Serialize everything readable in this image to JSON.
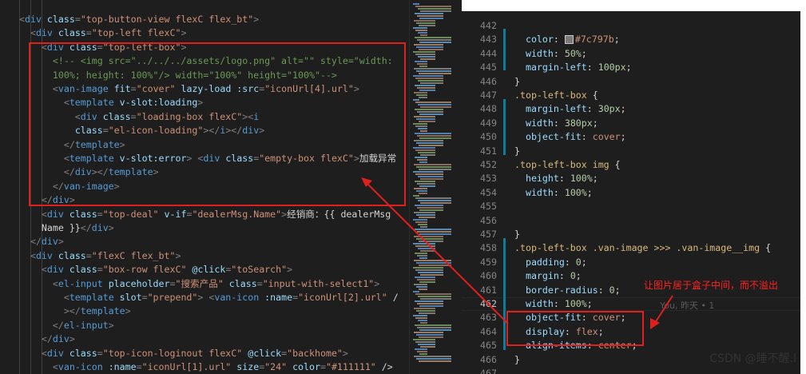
{
  "left_lines": [
    [
      [
        "t-punc",
        "<"
      ],
      [
        "t-tag",
        "div"
      ],
      [
        "t-text",
        " "
      ],
      [
        "t-attr",
        "class"
      ],
      [
        "t-punc",
        "="
      ],
      [
        "t-str",
        "\"top-button-view flexC flex_bt\""
      ],
      [
        "t-punc",
        ">"
      ]
    ],
    [
      [
        "t-punc",
        "  <"
      ],
      [
        "t-tag",
        "div"
      ],
      [
        "t-text",
        " "
      ],
      [
        "t-attr",
        "class"
      ],
      [
        "t-punc",
        "="
      ],
      [
        "t-str",
        "\"top-left flexC\""
      ],
      [
        "t-punc",
        ">"
      ]
    ],
    [
      [
        "t-punc",
        "    <"
      ],
      [
        "t-tag",
        "div"
      ],
      [
        "t-text",
        " "
      ],
      [
        "t-attr",
        "class"
      ],
      [
        "t-punc",
        "="
      ],
      [
        "t-str",
        "\"top-left-box\""
      ],
      [
        "t-punc",
        ">"
      ]
    ],
    [
      [
        "t-comm",
        "      <!-- <img src=\"../../../assets/logo.png\" alt=\"\" style=\"width:"
      ]
    ],
    [
      [
        "t-comm",
        "      100%; height: 100%\"/> width=\"100%\" height=\"100%\"-->"
      ]
    ],
    [
      [
        "t-punc",
        "      <"
      ],
      [
        "t-tag",
        "van-image"
      ],
      [
        "t-text",
        " "
      ],
      [
        "t-attr",
        "fit"
      ],
      [
        "t-punc",
        "="
      ],
      [
        "t-str",
        "\"cover\""
      ],
      [
        "t-text",
        " "
      ],
      [
        "t-attr",
        "lazy-load"
      ],
      [
        "t-text",
        " "
      ],
      [
        "t-attr",
        ":src"
      ],
      [
        "t-punc",
        "="
      ],
      [
        "t-str",
        "\"iconUrl[4].url\""
      ],
      [
        "t-punc",
        ">"
      ]
    ],
    [
      [
        "t-punc",
        "        <"
      ],
      [
        "t-tag",
        "template"
      ],
      [
        "t-text",
        " "
      ],
      [
        "t-attr",
        "v-slot:loading"
      ],
      [
        "t-punc",
        ">"
      ]
    ],
    [
      [
        "t-punc",
        "          <"
      ],
      [
        "t-tag",
        "div"
      ],
      [
        "t-text",
        " "
      ],
      [
        "t-attr",
        "class"
      ],
      [
        "t-punc",
        "="
      ],
      [
        "t-str",
        "\"loading-box flexC\""
      ],
      [
        "t-punc",
        "><"
      ],
      [
        "t-tag",
        "i"
      ]
    ],
    [
      [
        "t-text",
        "          "
      ],
      [
        "t-attr",
        "class"
      ],
      [
        "t-punc",
        "="
      ],
      [
        "t-str",
        "\"el-icon-loading\""
      ],
      [
        "t-punc",
        "></"
      ],
      [
        "t-tag",
        "i"
      ],
      [
        "t-punc",
        "></"
      ],
      [
        "t-tag",
        "div"
      ],
      [
        "t-punc",
        ">"
      ]
    ],
    [
      [
        "t-punc",
        "        </"
      ],
      [
        "t-tag",
        "template"
      ],
      [
        "t-punc",
        ">"
      ]
    ],
    [
      [
        "t-punc",
        "        <"
      ],
      [
        "t-tag",
        "template"
      ],
      [
        "t-text",
        " "
      ],
      [
        "t-attr",
        "v-slot:error"
      ],
      [
        "t-punc",
        "> <"
      ],
      [
        "t-tag",
        "div"
      ],
      [
        "t-text",
        " "
      ],
      [
        "t-attr",
        "class"
      ],
      [
        "t-punc",
        "="
      ],
      [
        "t-str",
        "\"empty-box flexC\""
      ],
      [
        "t-punc",
        ">"
      ],
      [
        "t-cn",
        "加载异常"
      ]
    ],
    [
      [
        "t-punc",
        "        </"
      ],
      [
        "t-tag",
        "div"
      ],
      [
        "t-punc",
        "></"
      ],
      [
        "t-tag",
        "template"
      ],
      [
        "t-punc",
        ">"
      ]
    ],
    [
      [
        "t-punc",
        "      </"
      ],
      [
        "t-tag",
        "van-image"
      ],
      [
        "t-punc",
        ">"
      ]
    ],
    [
      [
        "t-punc",
        "    </"
      ],
      [
        "t-tag",
        "div"
      ],
      [
        "t-punc",
        ">"
      ]
    ],
    [
      [
        "t-punc",
        "    <"
      ],
      [
        "t-tag",
        "div"
      ],
      [
        "t-text",
        " "
      ],
      [
        "t-attr",
        "class"
      ],
      [
        "t-punc",
        "="
      ],
      [
        "t-str",
        "\"top-deal\""
      ],
      [
        "t-text",
        " "
      ],
      [
        "t-attr",
        "v-if"
      ],
      [
        "t-punc",
        "="
      ],
      [
        "t-str",
        "\"dealerMsg.Name\""
      ],
      [
        "t-punc",
        ">"
      ],
      [
        "t-cn",
        "经销商："
      ],
      [
        "t-text",
        "{{ dealerMsg"
      ]
    ],
    [
      [
        "t-text",
        "    Name }}"
      ],
      [
        "t-punc",
        "</"
      ],
      [
        "t-tag",
        "div"
      ],
      [
        "t-punc",
        ">"
      ]
    ],
    [
      [
        "t-punc",
        "  </"
      ],
      [
        "t-tag",
        "div"
      ],
      [
        "t-punc",
        ">"
      ]
    ],
    [
      [
        "t-punc",
        "  <"
      ],
      [
        "t-tag",
        "div"
      ],
      [
        "t-text",
        " "
      ],
      [
        "t-attr",
        "class"
      ],
      [
        "t-punc",
        "="
      ],
      [
        "t-str",
        "\"flexC flex_bt\""
      ],
      [
        "t-punc",
        ">"
      ]
    ],
    [
      [
        "t-punc",
        "    <"
      ],
      [
        "t-tag",
        "div"
      ],
      [
        "t-text",
        " "
      ],
      [
        "t-attr",
        "class"
      ],
      [
        "t-punc",
        "="
      ],
      [
        "t-str",
        "\"box-row flexC\""
      ],
      [
        "t-text",
        " "
      ],
      [
        "t-attr",
        "@click"
      ],
      [
        "t-punc",
        "="
      ],
      [
        "t-str",
        "\"toSearch\""
      ],
      [
        "t-punc",
        ">"
      ]
    ],
    [
      [
        "t-punc",
        "      <"
      ],
      [
        "t-tag",
        "el-input"
      ],
      [
        "t-text",
        " "
      ],
      [
        "t-attr",
        "placeholder"
      ],
      [
        "t-punc",
        "="
      ],
      [
        "t-str",
        "\"搜索产品\""
      ],
      [
        "t-text",
        " "
      ],
      [
        "t-attr",
        "class"
      ],
      [
        "t-punc",
        "="
      ],
      [
        "t-str",
        "\"input-with-select1\""
      ],
      [
        "t-punc",
        ">"
      ]
    ],
    [
      [
        "t-punc",
        "        <"
      ],
      [
        "t-tag",
        "template"
      ],
      [
        "t-text",
        " "
      ],
      [
        "t-attr",
        "slot"
      ],
      [
        "t-punc",
        "="
      ],
      [
        "t-str",
        "\"prepend\""
      ],
      [
        "t-punc",
        "> <"
      ],
      [
        "t-tag",
        "van-icon"
      ],
      [
        "t-text",
        " "
      ],
      [
        "t-attr",
        ":name"
      ],
      [
        "t-punc",
        "="
      ],
      [
        "t-str",
        "\"iconUrl[2].url\""
      ],
      [
        "t-text",
        " /"
      ]
    ],
    [
      [
        "t-punc",
        "        ></"
      ],
      [
        "t-tag",
        "template"
      ],
      [
        "t-punc",
        ">"
      ]
    ],
    [
      [
        "t-punc",
        "      </"
      ],
      [
        "t-tag",
        "el-input"
      ],
      [
        "t-punc",
        ">"
      ]
    ],
    [
      [
        "t-punc",
        "    </"
      ],
      [
        "t-tag",
        "div"
      ],
      [
        "t-punc",
        ">"
      ]
    ],
    [
      [
        "t-punc",
        "    <"
      ],
      [
        "t-tag",
        "div"
      ],
      [
        "t-text",
        " "
      ],
      [
        "t-attr",
        "class"
      ],
      [
        "t-punc",
        "="
      ],
      [
        "t-str",
        "\"top-icon-loginout flexC\""
      ],
      [
        "t-text",
        " "
      ],
      [
        "t-attr",
        "@click"
      ],
      [
        "t-punc",
        "="
      ],
      [
        "t-str",
        "\"backhome\""
      ],
      [
        "t-punc",
        ">"
      ]
    ],
    [
      [
        "t-punc",
        "      <"
      ],
      [
        "t-tag",
        "van-icon"
      ],
      [
        "t-text",
        " "
      ],
      [
        "t-attr",
        ":name"
      ],
      [
        "t-punc",
        "="
      ],
      [
        "t-str",
        "\"iconUrl[1].url\""
      ],
      [
        "t-text",
        " "
      ],
      [
        "t-attr",
        "size"
      ],
      [
        "t-punc",
        "="
      ],
      [
        "t-str",
        "\"24\""
      ],
      [
        "t-text",
        " "
      ],
      [
        "t-attr",
        "color"
      ],
      [
        "t-punc",
        "="
      ],
      [
        "t-str",
        "\"#111111\""
      ],
      [
        "t-text",
        " />"
      ]
    ]
  ],
  "right_lines": [
    {
      "n": "442",
      "tokens": []
    },
    {
      "n": "443",
      "tokens": [
        [
          "t-prop",
          "  color"
        ],
        [
          "t-text",
          ": "
        ],
        [
          "swatch",
          ""
        ],
        [
          "t-val",
          "#7c797b"
        ],
        [
          "t-text",
          ";"
        ]
      ]
    },
    {
      "n": "444",
      "tokens": [
        [
          "t-prop",
          "  width"
        ],
        [
          "t-text",
          ": "
        ],
        [
          "t-num",
          "50%"
        ],
        [
          "t-text",
          ";"
        ]
      ]
    },
    {
      "n": "445",
      "tokens": [
        [
          "t-prop",
          "  margin-left"
        ],
        [
          "t-text",
          ": "
        ],
        [
          "t-num",
          "100px"
        ],
        [
          "t-text",
          ";"
        ]
      ]
    },
    {
      "n": "446",
      "tokens": [
        [
          "t-brace",
          "}"
        ]
      ]
    },
    {
      "n": "447",
      "tokens": [
        [
          "t-sel",
          ".top-left-box"
        ],
        [
          "t-brace",
          " {"
        ]
      ]
    },
    {
      "n": "448",
      "tokens": [
        [
          "t-prop",
          "  margin-left"
        ],
        [
          "t-text",
          ": "
        ],
        [
          "t-num",
          "30px"
        ],
        [
          "t-text",
          ";"
        ]
      ]
    },
    {
      "n": "449",
      "tokens": [
        [
          "t-prop",
          "  width"
        ],
        [
          "t-text",
          ": "
        ],
        [
          "t-num",
          "380px"
        ],
        [
          "t-text",
          ";"
        ]
      ]
    },
    {
      "n": "450",
      "tokens": [
        [
          "t-prop",
          "  object-fit"
        ],
        [
          "t-text",
          ": "
        ],
        [
          "t-val",
          "cover"
        ],
        [
          "t-text",
          ";"
        ]
      ]
    },
    {
      "n": "451",
      "tokens": [
        [
          "t-brace",
          "}"
        ]
      ]
    },
    {
      "n": "452",
      "tokens": [
        [
          "t-sel",
          ".top-left-box img"
        ],
        [
          "t-brace",
          " {"
        ]
      ]
    },
    {
      "n": "453",
      "tokens": [
        [
          "t-prop",
          "  height"
        ],
        [
          "t-text",
          ": "
        ],
        [
          "t-num",
          "100%"
        ],
        [
          "t-text",
          ";"
        ]
      ]
    },
    {
      "n": "454",
      "tokens": [
        [
          "t-prop",
          "  width"
        ],
        [
          "t-text",
          ": "
        ],
        [
          "t-num",
          "100%"
        ],
        [
          "t-text",
          ";"
        ]
      ]
    },
    {
      "n": "455",
      "tokens": []
    },
    {
      "n": "456",
      "tokens": []
    },
    {
      "n": "457",
      "tokens": [
        [
          "t-brace",
          "}"
        ]
      ]
    },
    {
      "n": "458",
      "tokens": [
        [
          "t-sel",
          ".top-left-box .van-image >>> .van-image__img"
        ],
        [
          "t-brace",
          " {"
        ]
      ]
    },
    {
      "n": "459",
      "tokens": [
        [
          "t-prop",
          "  padding"
        ],
        [
          "t-text",
          ": "
        ],
        [
          "t-num",
          "0"
        ],
        [
          "t-text",
          ";"
        ]
      ]
    },
    {
      "n": "460",
      "tokens": [
        [
          "t-prop",
          "  margin"
        ],
        [
          "t-text",
          ": "
        ],
        [
          "t-num",
          "0"
        ],
        [
          "t-text",
          ";"
        ]
      ]
    },
    {
      "n": "461",
      "tokens": [
        [
          "t-prop",
          "  border-radius"
        ],
        [
          "t-text",
          ": "
        ],
        [
          "t-num",
          "0"
        ],
        [
          "t-text",
          ";"
        ]
      ]
    },
    {
      "n": "462",
      "tokens": [
        [
          "t-prop",
          "  width"
        ],
        [
          "t-text",
          ": "
        ],
        [
          "t-num",
          "100%"
        ],
        [
          "t-text",
          ";"
        ]
      ]
    },
    {
      "n": "463",
      "tokens": [
        [
          "t-prop",
          "  object-fit"
        ],
        [
          "t-text",
          ": "
        ],
        [
          "t-val",
          "cover"
        ],
        [
          "t-text",
          ";"
        ]
      ]
    },
    {
      "n": "464",
      "tokens": [
        [
          "t-prop",
          "  display"
        ],
        [
          "t-text",
          ": "
        ],
        [
          "t-val",
          "flex"
        ],
        [
          "t-text",
          ";"
        ]
      ]
    },
    {
      "n": "465",
      "tokens": [
        [
          "t-prop",
          "  align-items"
        ],
        [
          "t-text",
          ": "
        ],
        [
          "t-val",
          "center"
        ],
        [
          "t-text",
          ";"
        ]
      ]
    },
    {
      "n": "466",
      "tokens": [
        [
          "t-brace",
          "}"
        ]
      ]
    },
    {
      "n": "467",
      "tokens": []
    }
  ],
  "right_lines_visible_numbers": [
    "442",
    "443",
    "444",
    "445",
    "446",
    "447",
    "448",
    "449",
    "450",
    "451",
    "452",
    "453",
    "454",
    "455",
    "456",
    "457",
    "458",
    "459",
    "460",
    "461",
    "462",
    "463",
    "464",
    "465",
    "466"
  ],
  "current_line": "462",
  "blame_text": "You, 昨天 • 1",
  "annotation_text": "让图片居于盒子中间，而不溢出",
  "watermark": "CSDN @睡不醒.l",
  "colors": {
    "annotation": "#e0201e",
    "editor_bg": "#1e1e1e",
    "swatch": "#7c797b"
  }
}
